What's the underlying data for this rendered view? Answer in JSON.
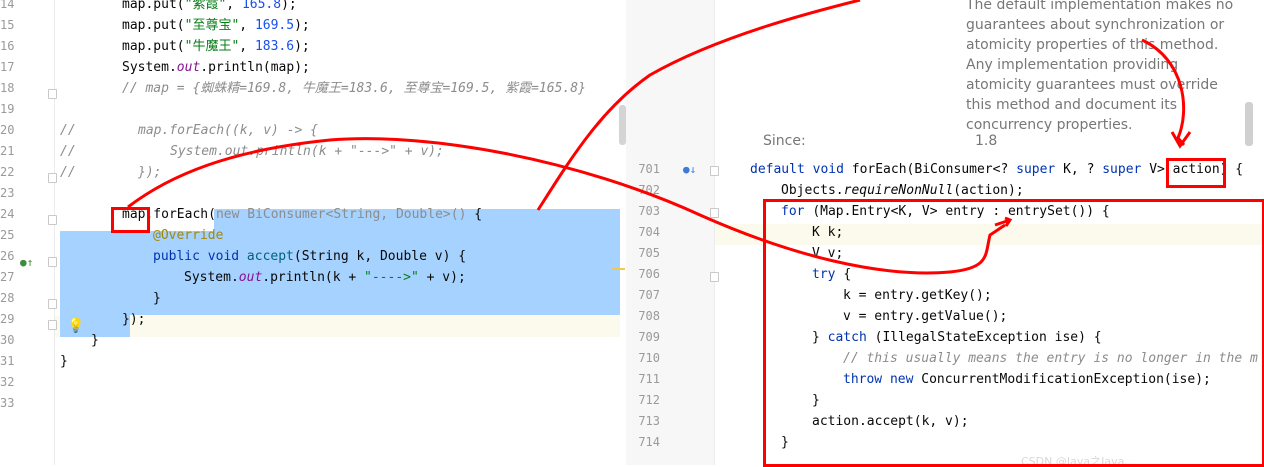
{
  "left_editor": {
    "line_numbers": [
      "14",
      "15",
      "16",
      "17",
      "18",
      "19",
      "20",
      "21",
      "22",
      "23",
      "24",
      "25",
      "26",
      "27",
      "28",
      "29",
      "30",
      "31",
      "32",
      "33"
    ],
    "lines": {
      "l14": {
        "a": "map.put(",
        "s": "\"紫霞\"",
        "b": ", ",
        "n": "165.8",
        "c": ");"
      },
      "l15": {
        "a": "map.put(",
        "s": "\"至尊宝\"",
        "b": ", ",
        "n": "169.5",
        "c": ");"
      },
      "l16": {
        "a": "map.put(",
        "s": "\"牛魔王\"",
        "b": ", ",
        "n": "183.6",
        "c": ");"
      },
      "l17": {
        "a": "System.",
        "f": "out",
        "b": ".println(map);"
      },
      "l18": {
        "cm": "// map = {蜘蛛精=169.8, 牛魔王=183.6, 至尊宝=169.5, 紫霞=165.8}"
      },
      "l20": {
        "slashes": "//",
        "cm": "map.forEach((k, v) -> {"
      },
      "l21": {
        "slashes": "//",
        "cm": "System.out.println(k + \"--->\" + v);"
      },
      "l22": {
        "slashes": "//",
        "cm": "});"
      },
      "l24": {
        "a": "map",
        "b": ".forEach(",
        "gray": "new BiConsumer<String, Double>()",
        "c": " {"
      },
      "l25": {
        "ann": "@Override"
      },
      "l26": {
        "kw": "public void ",
        "m": "accept",
        "b": "(String k, Double v) {"
      },
      "l27": {
        "a": "System.",
        "f": "out",
        "b": ".println(k + ",
        "s": "\"---->\"",
        "c": " + v);"
      },
      "l28": {
        "a": "}"
      },
      "l29": {
        "a": "});"
      },
      "l30": {
        "a": "}"
      },
      "l31": {
        "a": "}"
      }
    }
  },
  "right_editor": {
    "docs_lines": [
      "The default implementation makes no",
      "guarantees about synchronization or",
      "atomicity properties of this method.",
      "Any implementation providing",
      "atomicity guarantees must override",
      "this method and document its",
      "concurrency properties."
    ],
    "since_label": "Since:",
    "since_value": "1.8",
    "line_numbers": [
      "701",
      "702",
      "703",
      "704",
      "705",
      "706",
      "707",
      "708",
      "709",
      "710",
      "711",
      "712",
      "713",
      "714"
    ],
    "lines": {
      "r701": {
        "kw": "default void ",
        "a": "forEach(BiConsumer<? ",
        "kw2": "super",
        "b": " K, ? ",
        "kw3": "super",
        "c": " V> action) {"
      },
      "r702": {
        "a": "Objects.",
        "i": "requireNonNull",
        "b": "(action);"
      },
      "r703": {
        "kw": "for ",
        "a": "(Map.Entry<K, V> entry : entrySet()) {"
      },
      "r704": {
        "a": "K k;"
      },
      "r705": {
        "a": "V v;"
      },
      "r706": {
        "kw": "try ",
        "a": "{"
      },
      "r707": {
        "a": "k = entry.getKey();"
      },
      "r708": {
        "a": "v = entry.getValue();"
      },
      "r709": {
        "a": "} ",
        "kw": "catch ",
        "b": "(IllegalStateException ise) {"
      },
      "r710": {
        "cm": "// this usually means the entry is no longer in the m"
      },
      "r711": {
        "kw": "throw new ",
        "a": "ConcurrentModificationException(ise);"
      },
      "r712": {
        "a": "}"
      },
      "r713": {
        "a": "action.accept(k, v);"
      },
      "r714": {
        "a": "}"
      }
    },
    "watermark": "CSDN @Java之Java..."
  },
  "colors": {
    "selection": "#a6d2ff",
    "annotation_red": "#ff0000",
    "string": "#067d17",
    "number": "#1750eb",
    "keyword": "#0033b3",
    "comment": "#8c8c8c",
    "field": "#871094"
  }
}
